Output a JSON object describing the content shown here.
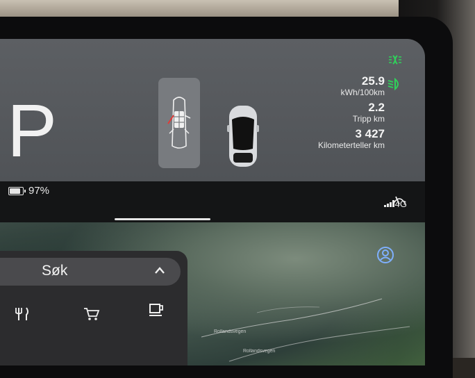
{
  "status": {
    "gear": "P",
    "battery_percent_label": "97%",
    "stats": [
      {
        "value": "25.9",
        "label": "kWh/100km"
      },
      {
        "value": "2.2",
        "label": "Tripp km"
      },
      {
        "value": "3 427",
        "label": "Kilometerteller km"
      }
    ],
    "network_label": "4G",
    "indicator_color": "#2fd25a"
  },
  "search": {
    "label": "Søk",
    "categories": [
      "restaurant-icon",
      "shopping-cart-icon",
      "cafe-icon"
    ]
  },
  "map": {
    "road_labels": [
      "Rollandsvegen",
      "Rollandsvegen"
    ]
  },
  "icons": [
    "battery-icon",
    "fog-light-icon",
    "low-beam-icon",
    "wiper-icon",
    "profile-icon",
    "chevron-up-icon",
    "signal-icon"
  ]
}
